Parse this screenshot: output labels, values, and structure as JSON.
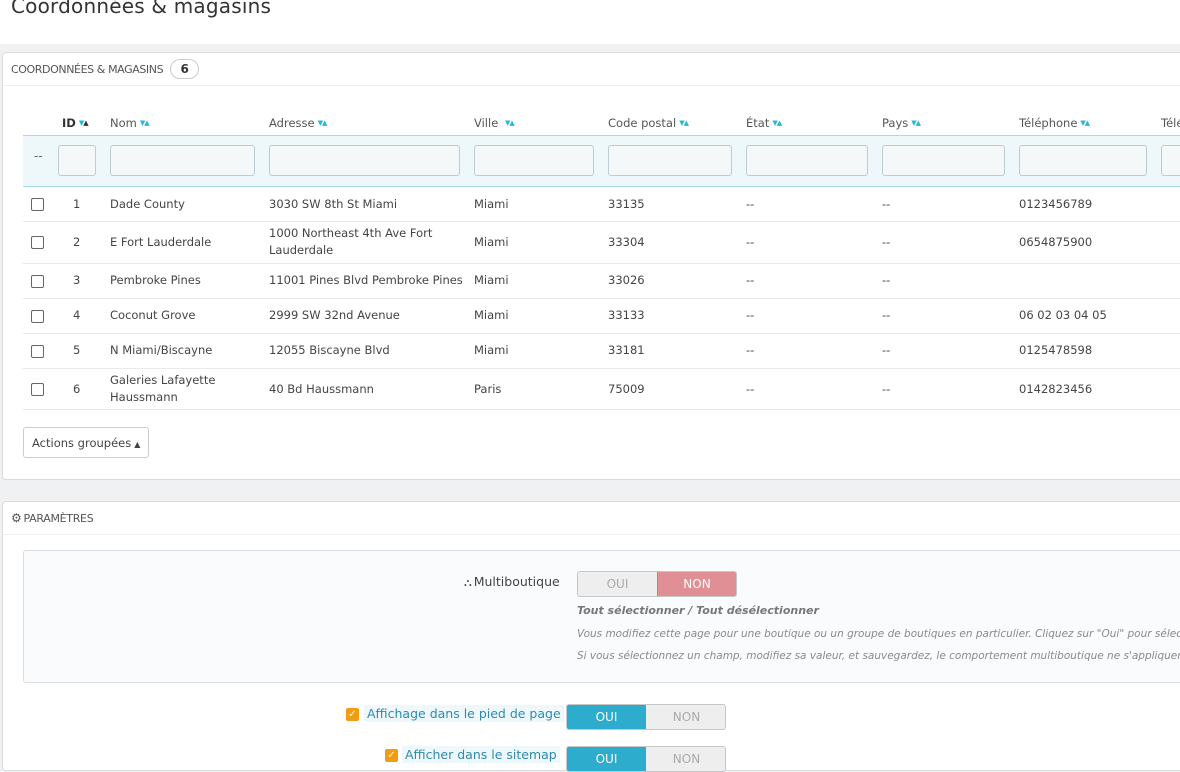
{
  "page": {
    "title": "Coordonnées & magasins"
  },
  "stores_panel": {
    "title": "Coordonnées & magasins",
    "count": "6",
    "columns": [
      "ID",
      "Nom",
      "Adresse",
      "Ville",
      "Code postal",
      "État",
      "Pays",
      "Téléphone",
      "Télé"
    ],
    "filter_dash": "--",
    "rows": [
      {
        "id": "1",
        "name": "Dade County",
        "address": "3030 SW 8th St Miami",
        "city": "Miami",
        "zip": "33135",
        "state": "--",
        "country": "--",
        "phone": "0123456789"
      },
      {
        "id": "2",
        "name": "E Fort Lauderdale",
        "address": "1000 Northeast 4th Ave Fort Lauderdale",
        "city": "Miami",
        "zip": "33304",
        "state": "--",
        "country": "--",
        "phone": "0654875900"
      },
      {
        "id": "3",
        "name": "Pembroke Pines",
        "address": "11001 Pines Blvd Pembroke Pines",
        "city": "Miami",
        "zip": "33026",
        "state": "--",
        "country": "--",
        "phone": ""
      },
      {
        "id": "4",
        "name": "Coconut Grove",
        "address": "2999 SW 32nd Avenue",
        "city": "Miami",
        "zip": "33133",
        "state": "--",
        "country": "--",
        "phone": "06 02 03 04 05"
      },
      {
        "id": "5",
        "name": "N Miami/Biscayne",
        "address": "12055 Biscayne Blvd",
        "city": "Miami",
        "zip": "33181",
        "state": "--",
        "country": "--",
        "phone": "0125478598"
      },
      {
        "id": "6",
        "name": "Galeries Lafayette Haussmann",
        "address": "40 Bd Haussmann",
        "city": "Paris",
        "zip": "75009",
        "state": "--",
        "country": "--",
        "phone": "0142823456"
      }
    ],
    "bulk_actions": "Actions groupées"
  },
  "params_panel": {
    "title": "PARAMÈTRES",
    "multishop": {
      "label": "Multiboutique",
      "yes": "OUI",
      "no": "NON",
      "selected": "NON",
      "select_all": "Tout sélectionner / Tout désélectionner",
      "help1": "Vous modifiez cette page pour une boutique ou un groupe de boutiques en particulier. Cliquez sur \"Oui\" pour sélec",
      "help2": "Si vous sélectionnez un champ, modifiez sa valeur, et sauvegardez, le comportement multiboutique ne s'appliquera"
    },
    "options": [
      {
        "label": "Affichage dans le pied de page",
        "yes": "OUI",
        "no": "NON",
        "selected": "OUI",
        "checked": true
      },
      {
        "label": "Afficher dans le sitemap",
        "yes": "OUI",
        "no": "NON",
        "selected": "OUI",
        "checked": true
      }
    ]
  },
  "colors": {
    "accent": "#25b9d7",
    "toggle_on": "#2eacce",
    "toggle_no": "#e08f95",
    "checkbox": "#f39c12"
  },
  "icons": {
    "sort": "sort-arrows-icon",
    "gears": "gears-icon",
    "sitemap": "sitemap-icon",
    "caret": "caret-up-icon"
  }
}
